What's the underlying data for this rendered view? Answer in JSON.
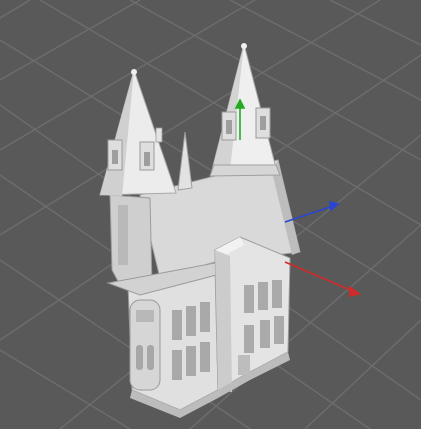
{
  "viewport": {
    "background_color": "#595959",
    "grid_color": "#6b6b6b",
    "model_color": "#e6e6e6",
    "axis_colors": {
      "x": "#d22a2a",
      "y": "#22aa22",
      "z": "#2a45d2"
    },
    "icons": {
      "axis_gizmo": "xyz-axis-gizmo-icon",
      "model": "castle-3d-model"
    }
  }
}
